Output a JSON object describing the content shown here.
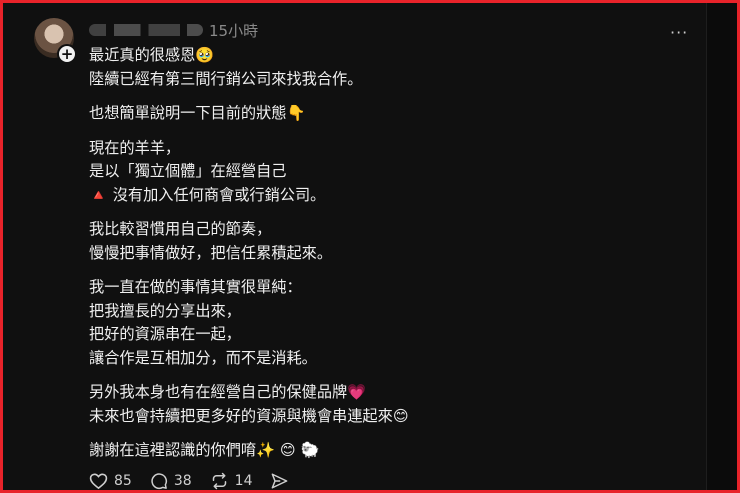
{
  "post": {
    "time": "15小時",
    "more_label": "···",
    "paragraphs": [
      [
        "最近真的很感恩🥹",
        "陸續已經有第三間行銷公司來找我合作。"
      ],
      [
        "也想簡單說明一下目前的狀態👇"
      ],
      [
        "現在的羊羊，",
        "是以「獨立個體」在經營自己",
        "🔺 沒有加入任何商會或行銷公司。"
      ],
      [
        "我比較習慣用自己的節奏，",
        "慢慢把事情做好，把信任累積起來。"
      ],
      [
        "我一直在做的事情其實很單純：",
        "把我擅長的分享出來，",
        "把好的資源串在一起，",
        "讓合作是互相加分，而不是消耗。"
      ],
      [
        "另外我本身也有在經營自己的保健品牌💗",
        "未來也會持續把更多好的資源與機會串連起來😊"
      ],
      [
        "謝謝在這裡認識的你們唷✨ 😊 🐑"
      ]
    ]
  },
  "actions": {
    "likes": "85",
    "comments": "38",
    "reposts": "14"
  }
}
